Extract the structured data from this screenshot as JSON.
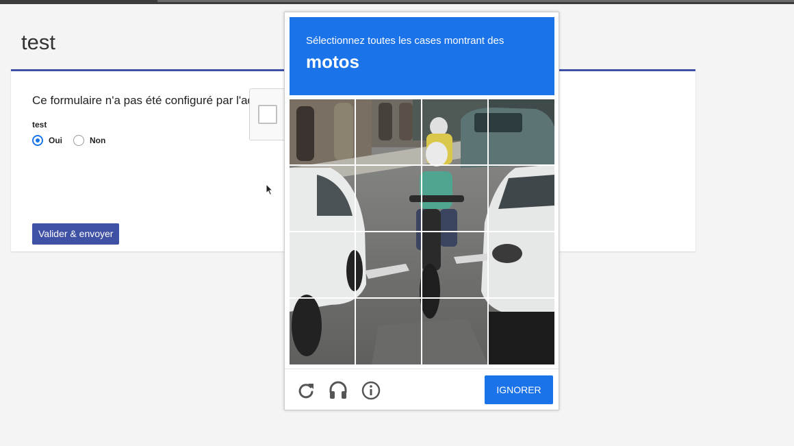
{
  "page": {
    "title": "test"
  },
  "form": {
    "message": "Ce formulaire n'a pas été configuré par l'admin",
    "question_label": "test",
    "options": [
      {
        "label": "Oui",
        "checked": true
      },
      {
        "label": "Non",
        "checked": false
      }
    ],
    "submit_label": "Valider & envoyer"
  },
  "captcha": {
    "instruction": "Sélectionnez toutes les cases montrant des",
    "target": "motos",
    "skip_label": "IGNORER",
    "footer_icons": [
      "reload-icon",
      "audio-icon",
      "info-icon"
    ],
    "grid": {
      "rows": 4,
      "cols": 4
    }
  },
  "colors": {
    "accent_blue": "#1a73e8",
    "form_primary": "#3f51a5"
  }
}
